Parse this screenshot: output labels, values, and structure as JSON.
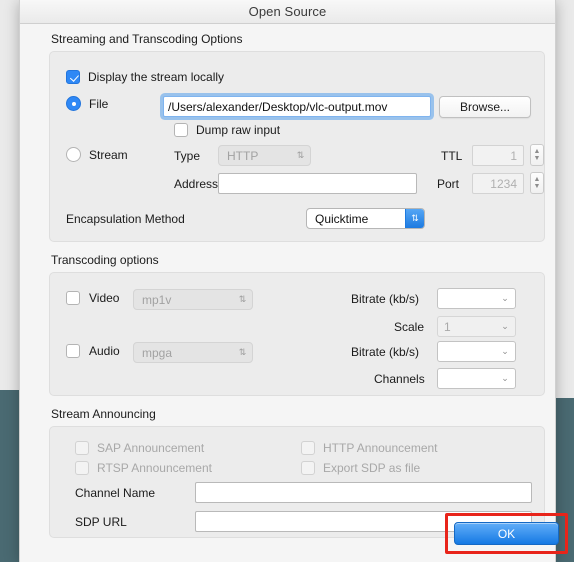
{
  "window": {
    "title": "Open Source"
  },
  "streaming": {
    "group_label": "Streaming and Transcoding Options",
    "display_locally": {
      "label": "Display the stream locally",
      "checked": true
    },
    "file": {
      "radio_label": "File",
      "selected": true,
      "path_value": "/Users/alexander/Desktop/vlc-output.mov",
      "browse_label": "Browse..."
    },
    "dump_raw": {
      "label": "Dump raw input",
      "checked": false
    },
    "stream": {
      "radio_label": "Stream",
      "selected": false,
      "type_label": "Type",
      "type_value": "HTTP",
      "address_label": "Address",
      "address_value": "",
      "ttl_label": "TTL",
      "ttl_value": "1",
      "port_label": "Port",
      "port_value": "1234"
    },
    "encapsulation": {
      "label": "Encapsulation Method",
      "value": "Quicktime"
    }
  },
  "transcoding": {
    "group_label": "Transcoding options",
    "video": {
      "label": "Video",
      "checked": false,
      "codec": "mp1v",
      "bitrate_label": "Bitrate (kb/s)",
      "bitrate_value": "",
      "scale_label": "Scale",
      "scale_value": "1"
    },
    "audio": {
      "label": "Audio",
      "checked": false,
      "codec": "mpga",
      "bitrate_label": "Bitrate (kb/s)",
      "bitrate_value": "",
      "channels_label": "Channels",
      "channels_value": ""
    }
  },
  "announcing": {
    "group_label": "Stream Announcing",
    "sap": {
      "label": "SAP Announcement",
      "checked": false
    },
    "http": {
      "label": "HTTP Announcement",
      "checked": false
    },
    "rtsp": {
      "label": "RTSP Announcement",
      "checked": false
    },
    "export_sdp": {
      "label": "Export SDP as file",
      "checked": false
    },
    "channel_name": {
      "label": "Channel Name",
      "value": ""
    },
    "sdp_url": {
      "label": "SDP URL",
      "value": ""
    }
  },
  "footer": {
    "ok_label": "OK"
  },
  "icons": {
    "chevron_updown": "⇅",
    "chevron_down": "⌄",
    "stepper_up": "▲",
    "stepper_down": "▼"
  },
  "colors": {
    "accent_blue": "#2f88f5",
    "annotation_red": "#e8241a",
    "desktop_teal": "#4a6a72"
  }
}
